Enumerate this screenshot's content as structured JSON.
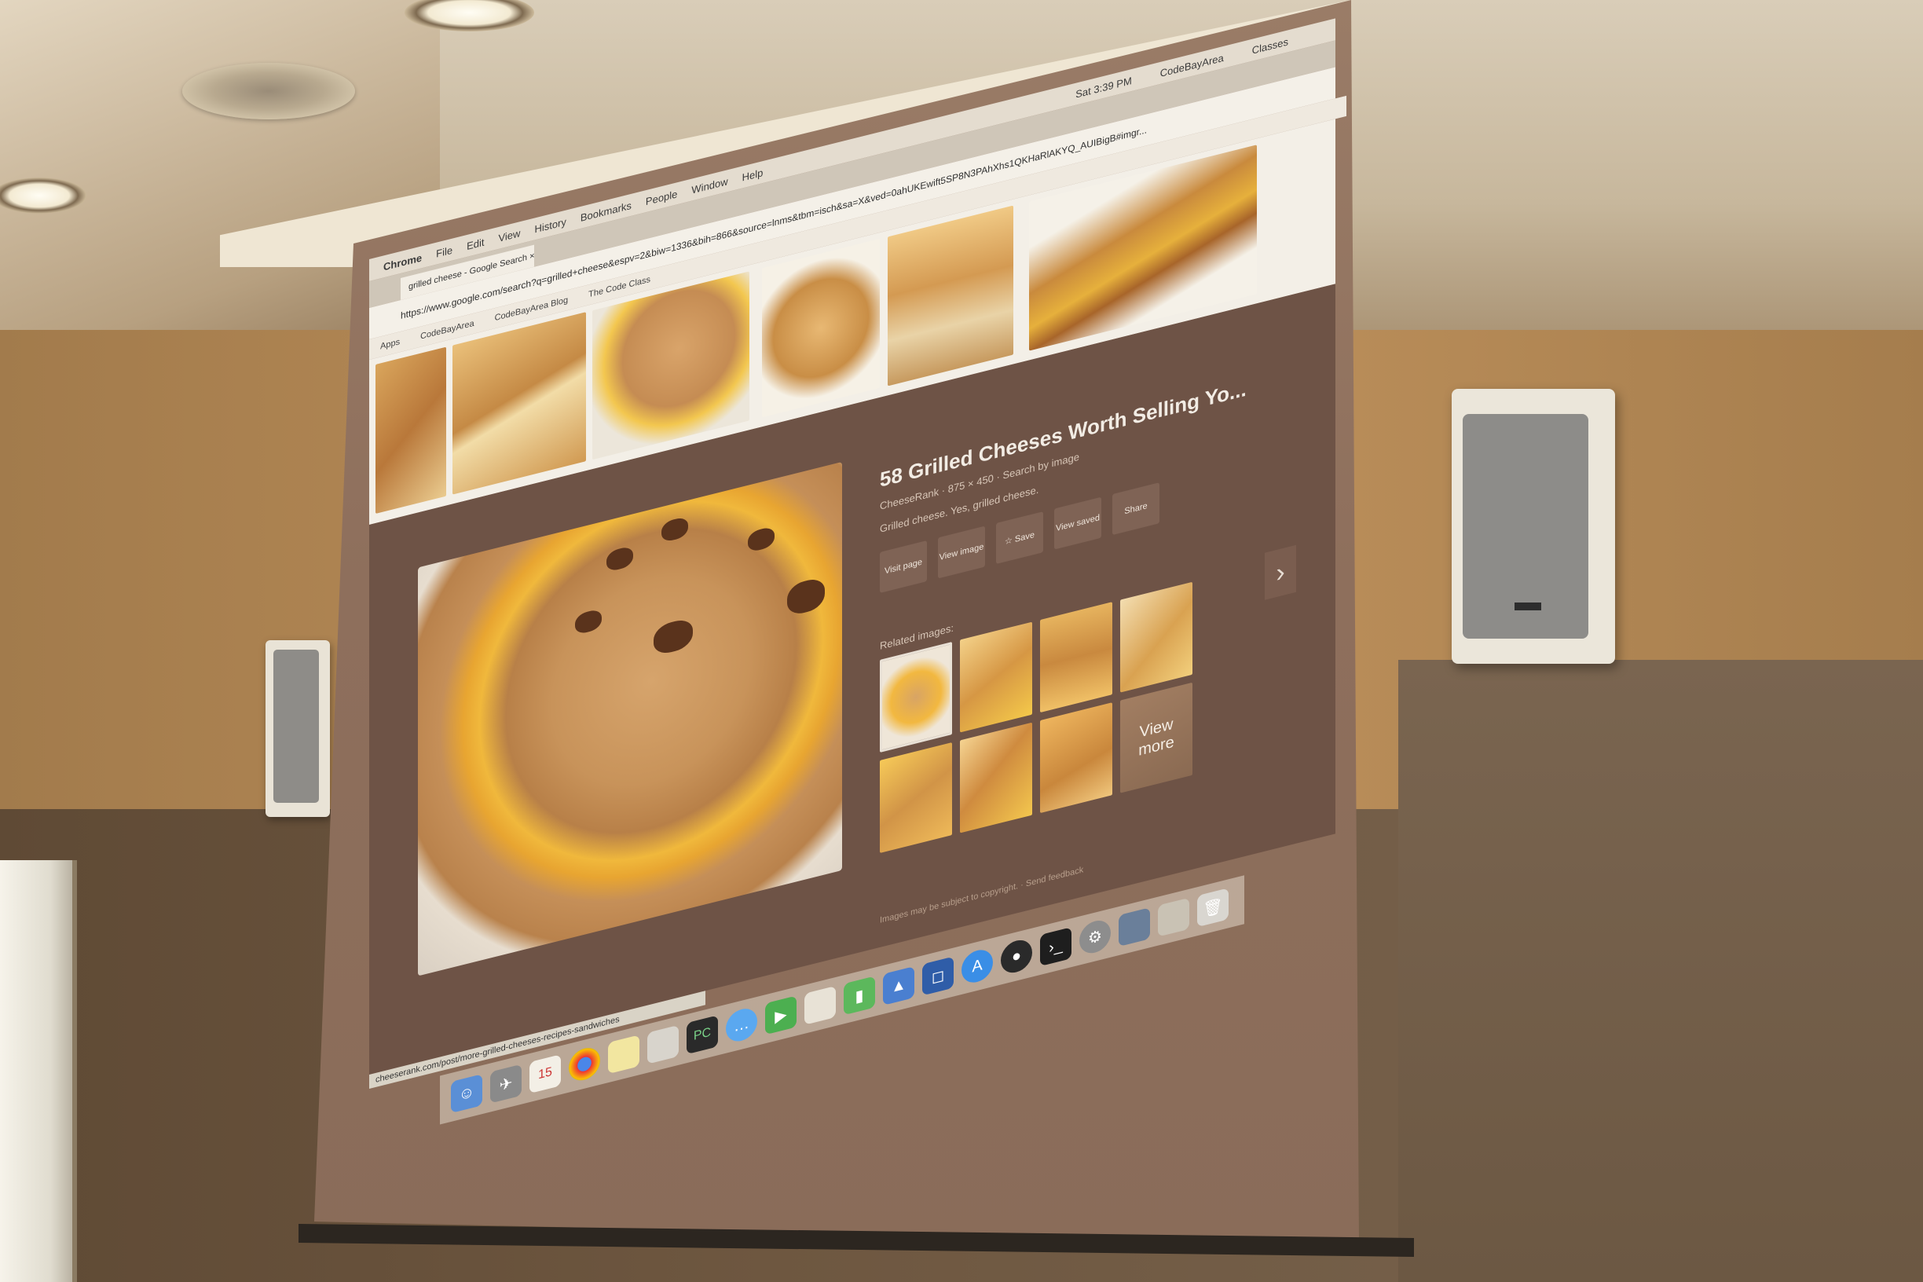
{
  "browser": {
    "menubar": {
      "app": "Chrome",
      "items": [
        "File",
        "Edit",
        "View",
        "History",
        "Bookmarks",
        "People",
        "Window",
        "Help"
      ],
      "clock": "Sat 3:39 PM",
      "user": "CodeBayArea",
      "button": "Classes"
    },
    "tab_title": "grilled cheese - Google Search ×",
    "url": "https://www.google.com/search?q=grilled+cheese&espv=2&biw=1336&bih=866&source=lnms&tbm=isch&sa=X&ved=0ahUKEwift5SP8N3PAhXhs1QKHaRlAKYQ_AUIBigB#imgr...",
    "bookmarks": [
      "Apps",
      "CodeBayArea",
      "CodeBayArea Blog",
      "The Code Class"
    ]
  },
  "result": {
    "title": "58 Grilled Cheeses Worth Selling Yo...",
    "meta": "CheeseRank · 875 × 450 · Search by image",
    "caption": "Grilled cheese. Yes, grilled cheese.",
    "actions": [
      "Visit page",
      "View image",
      "☆ Save",
      "View saved",
      "Share"
    ],
    "related_label": "Related images:",
    "view_more": "View more",
    "footer": "Images may be subject to copyright. · Send feedback"
  },
  "status_url": "cheeserank.com/post/more-grilled-cheeses-recipes-sandwiches",
  "dock": {
    "calendar_day": "15",
    "pycharm": "PC"
  },
  "colors": {
    "screen_panel": "#6e5346",
    "wall": "#b58955",
    "cheese": "#f2b840"
  }
}
